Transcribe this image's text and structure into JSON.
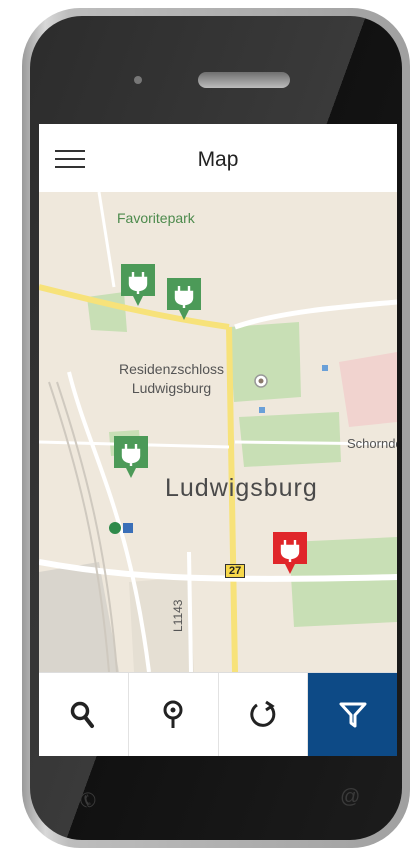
{
  "header": {
    "title": "Map"
  },
  "map": {
    "labels": {
      "park": "Favoritepark",
      "palace_line1": "Residenzschloss",
      "palace_line2": "Ludwigsburg",
      "town": "Schorndo",
      "city": "Ludwigsburg",
      "road_shield": "27",
      "road_vertical": "L1143",
      "station": "S"
    },
    "pins": [
      {
        "status": "available",
        "color": "#4c9a58"
      },
      {
        "status": "available",
        "color": "#4c9a58"
      },
      {
        "status": "available",
        "color": "#4c9a58"
      },
      {
        "status": "occupied",
        "color": "#e0262a"
      }
    ]
  },
  "toolbar": {
    "buttons": [
      {
        "name": "search",
        "icon": "search-icon"
      },
      {
        "name": "location",
        "icon": "map-pin-icon"
      },
      {
        "name": "refresh",
        "icon": "refresh-icon"
      },
      {
        "name": "filter",
        "icon": "filter-icon",
        "active": true
      }
    ]
  },
  "colors": {
    "accent": "#0d4a86",
    "pin_available": "#4c9a58",
    "pin_occupied": "#e0262a"
  }
}
